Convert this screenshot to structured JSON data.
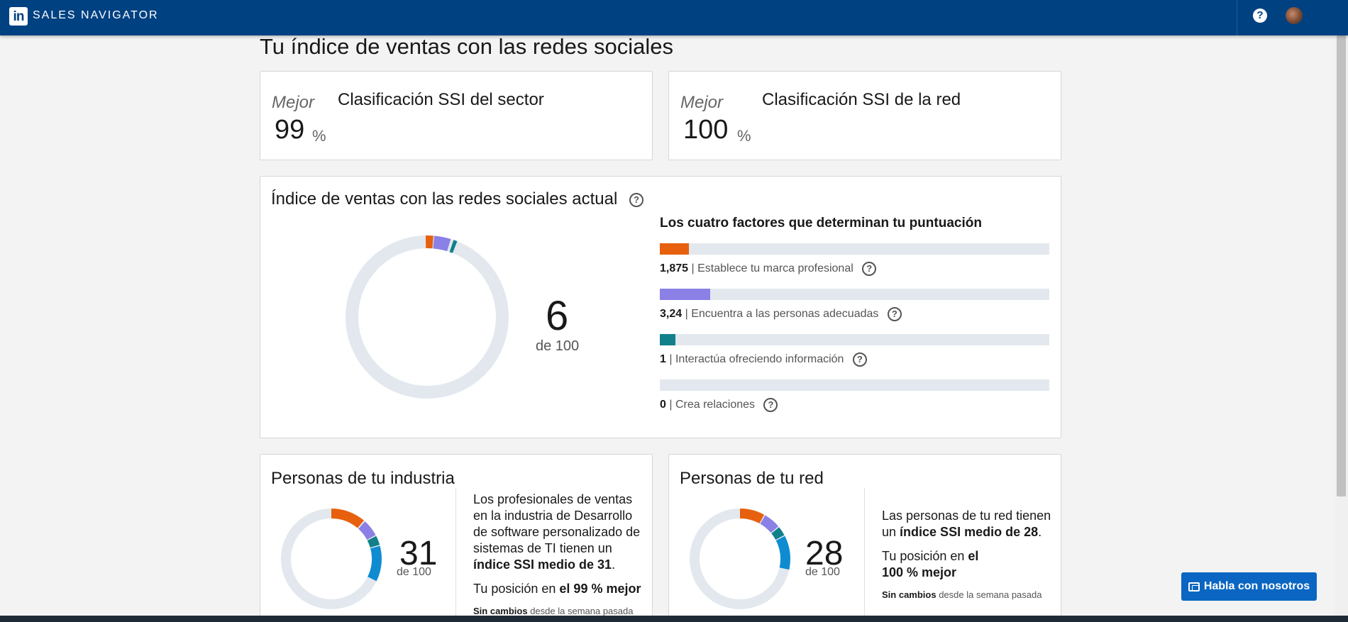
{
  "nav": {
    "logo": "in",
    "brand": "SALES NAVIGATOR",
    "help": "?"
  },
  "page": {
    "title": "Tu índice de ventas con las redes sociales"
  },
  "rank_sector": {
    "label": "Mejor",
    "title": "Clasificación SSI del sector",
    "value": "99",
    "unit": "%"
  },
  "rank_network": {
    "label": "Mejor",
    "title": "Clasificación SSI de la red",
    "value": "100",
    "unit": "%"
  },
  "ssi": {
    "title": "Índice de ventas con las redes sociales actual",
    "help_icon": "question-circle-icon",
    "score": "6",
    "out_of": "de 100",
    "factors_title": "Los cuatro factores que determinan tu puntuación",
    "factors": [
      {
        "value": "1,875",
        "label": "Establece tu marca profesional",
        "fraction": 0.075,
        "color": "#e7600e"
      },
      {
        "value": "3,24",
        "label": "Encuentra a las personas adecuadas",
        "fraction": 0.1296,
        "color": "#8a80e6"
      },
      {
        "value": "1",
        "label": "Interactúa ofreciendo información",
        "fraction": 0.04,
        "color": "#12808a"
      },
      {
        "value": "0",
        "label": "Crea relaciones",
        "fraction": 0,
        "color": "#0f8cd1"
      }
    ],
    "separator": "|"
  },
  "industry": {
    "title": "Personas de tu industria",
    "score": "31",
    "out_of": "de 100",
    "text_1": "Los profesionales de ventas en la industria de Desarrollo de software personalizado de sistemas de TI tienen un",
    "text_1_bold": "índice SSI medio de 31",
    "text_1_end": ".",
    "text_2": "Tu posición en",
    "text_2_bold": "el 99 % mejor",
    "change_bold": "Sin cambios",
    "change_rest": "desde la semana pasada"
  },
  "network": {
    "title": "Personas de tu red",
    "score": "28",
    "out_of": "de 100",
    "text_1": "Las personas de tu red tienen un",
    "text_1_bold": "índice SSI medio de 28",
    "text_1_end": ".",
    "text_2": "Tu posición en",
    "text_2_bold_a": "el",
    "text_2_bold_b": "100 % mejor",
    "change_bold": "Sin cambios",
    "change_rest": "desde la semana pasada"
  },
  "chat": {
    "label": "Habla con nosotros",
    "icon": "chat-bubbles-icon"
  },
  "colors": {
    "brand_nav": "#004182",
    "orange": "#e7600e",
    "purple": "#8a80e6",
    "teal": "#12808a",
    "blue": "#0f8cd1",
    "track": "#e2e8ee"
  }
}
